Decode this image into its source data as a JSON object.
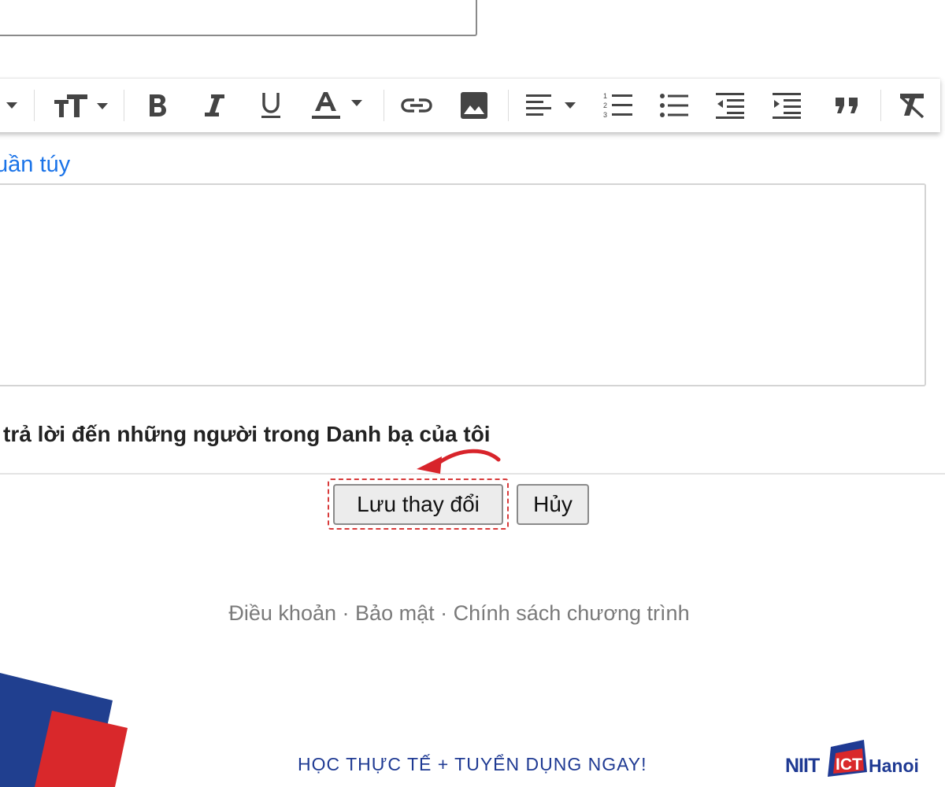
{
  "toolbar": {
    "icons": [
      "dropdown-arrow",
      "text-size",
      "bold",
      "italic",
      "underline",
      "text-color",
      "link",
      "image",
      "align",
      "numbered-list",
      "bulleted-list",
      "indent-less",
      "indent-more",
      "quote",
      "remove-formatting"
    ]
  },
  "editor": {
    "plain_text_link": "uần túy"
  },
  "auto_reply": {
    "contacts_only_label": "trả lời đến những người trong Danh bạ của tôi"
  },
  "actions": {
    "save_label": "Lưu thay đổi",
    "cancel_label": "Hủy"
  },
  "footer": {
    "terms": "Điều khoản",
    "separator": "·",
    "privacy": "Bảo mật",
    "program_policy": "Chính sách chương trình"
  },
  "branding": {
    "slogan": "HỌC THỰC TẾ + TUYỂN DỤNG NGAY!",
    "logo_text": "NIIT ICT Hanoi",
    "colors": {
      "blue": "#203f8f",
      "red": "#d9282b",
      "link": "#1a73e8",
      "highlight": "#d83a3a"
    }
  }
}
